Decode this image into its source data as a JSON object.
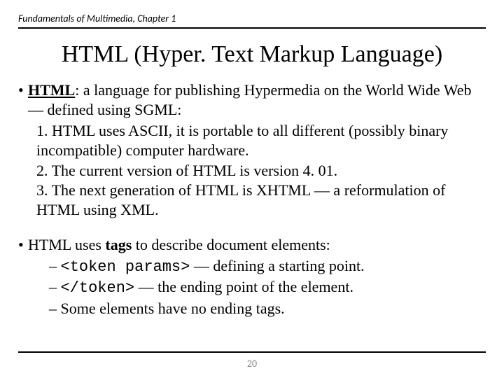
{
  "header": "Fundamentals of Multimedia, Chapter 1",
  "title": "HTML (Hyper. Text Markup Language)",
  "b1": {
    "term": "HTML",
    "rest": ": a language for publishing Hypermedia on the World Wide Web — defined using SGML:"
  },
  "num1": "1. HTML uses ASCII, it is portable to all different (possibly binary incompatible) computer hardware.",
  "num2": "2. The current version of HTML is version 4. 01.",
  "num3": "3. The next generation of HTML is XHTML — a reformulation of HTML using XML.",
  "b2": {
    "pre": "HTML uses ",
    "tags_word": "tags",
    "post": " to describe document elements:"
  },
  "d1": {
    "dash": "– ",
    "code": "<token params>",
    "rest": " — defining a starting point."
  },
  "d2": {
    "dash": "– ",
    "code": "</token>",
    "rest": " — the ending point of the element."
  },
  "d3": "– Some elements have no ending tags.",
  "page": "20"
}
